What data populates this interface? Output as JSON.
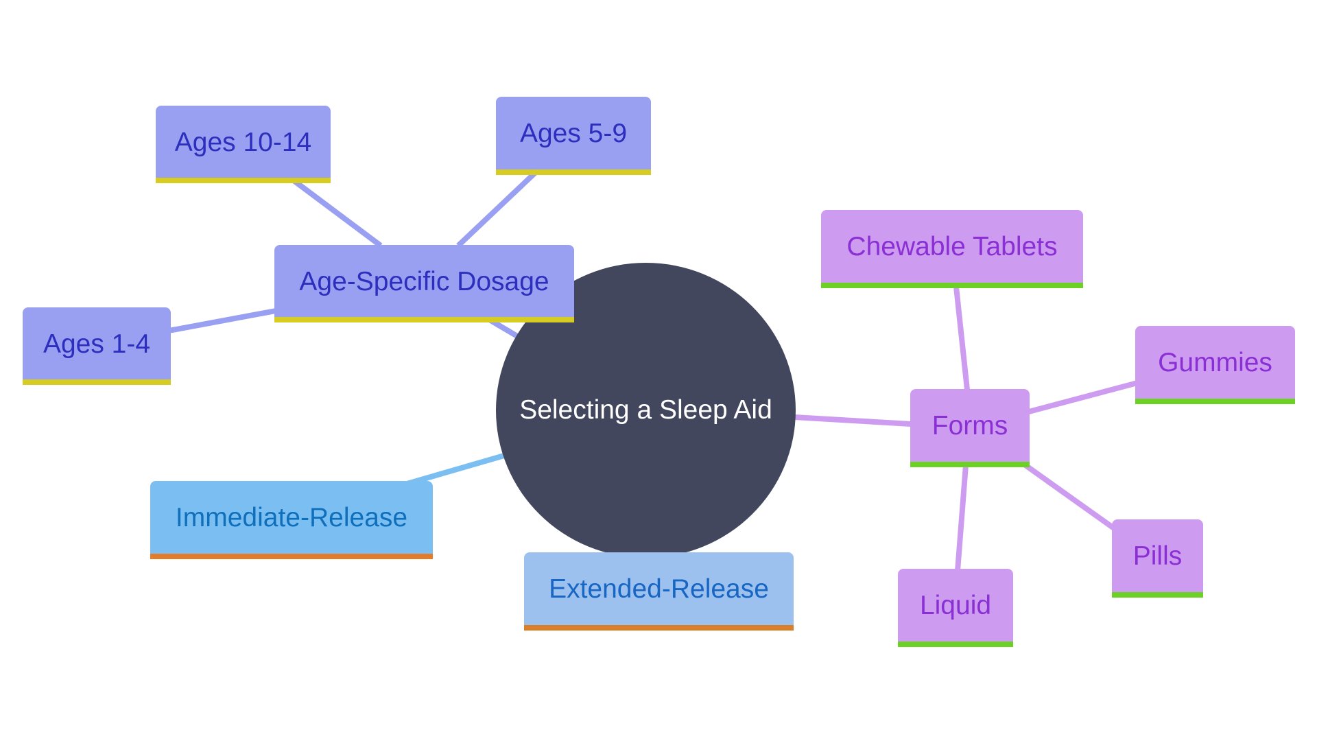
{
  "diagram": {
    "type": "mindmap",
    "root": {
      "label": "Selecting a Sleep Aid",
      "color": "#42475d"
    },
    "branches": [
      {
        "id": "age",
        "label": "Age-Specific Dosage",
        "fill": "#9aa0f1",
        "text": "#2c2fbd",
        "accent": "#d6cc22",
        "children": [
          {
            "id": "ages-10-14",
            "label": "Ages 10-14"
          },
          {
            "id": "ages-5-9",
            "label": "Ages 5-9"
          },
          {
            "id": "ages-1-4",
            "label": "Ages 1-4"
          }
        ]
      },
      {
        "id": "forms",
        "label": "Forms",
        "fill": "#cd9cf1",
        "text": "#8a2fd4",
        "accent": "#6cd124",
        "children": [
          {
            "id": "chewable",
            "label": "Chewable Tablets"
          },
          {
            "id": "gummies",
            "label": "Gummies"
          },
          {
            "id": "pills",
            "label": "Pills"
          },
          {
            "id": "liquid",
            "label": "Liquid"
          }
        ]
      },
      {
        "id": "immediate",
        "label": "Immediate-Release",
        "fill": "#7bbff2",
        "text": "#0f6fbb",
        "accent": "#e07c2c",
        "children": []
      },
      {
        "id": "extended",
        "label": "Extended-Release",
        "fill": "#9cc1ef",
        "text": "#1766c4",
        "accent": "#db7e2a",
        "children": []
      }
    ],
    "edge_colors": {
      "age": "#9aa0f1",
      "forms": "#cd9cf1",
      "immediate": "#7bbff2"
    }
  }
}
